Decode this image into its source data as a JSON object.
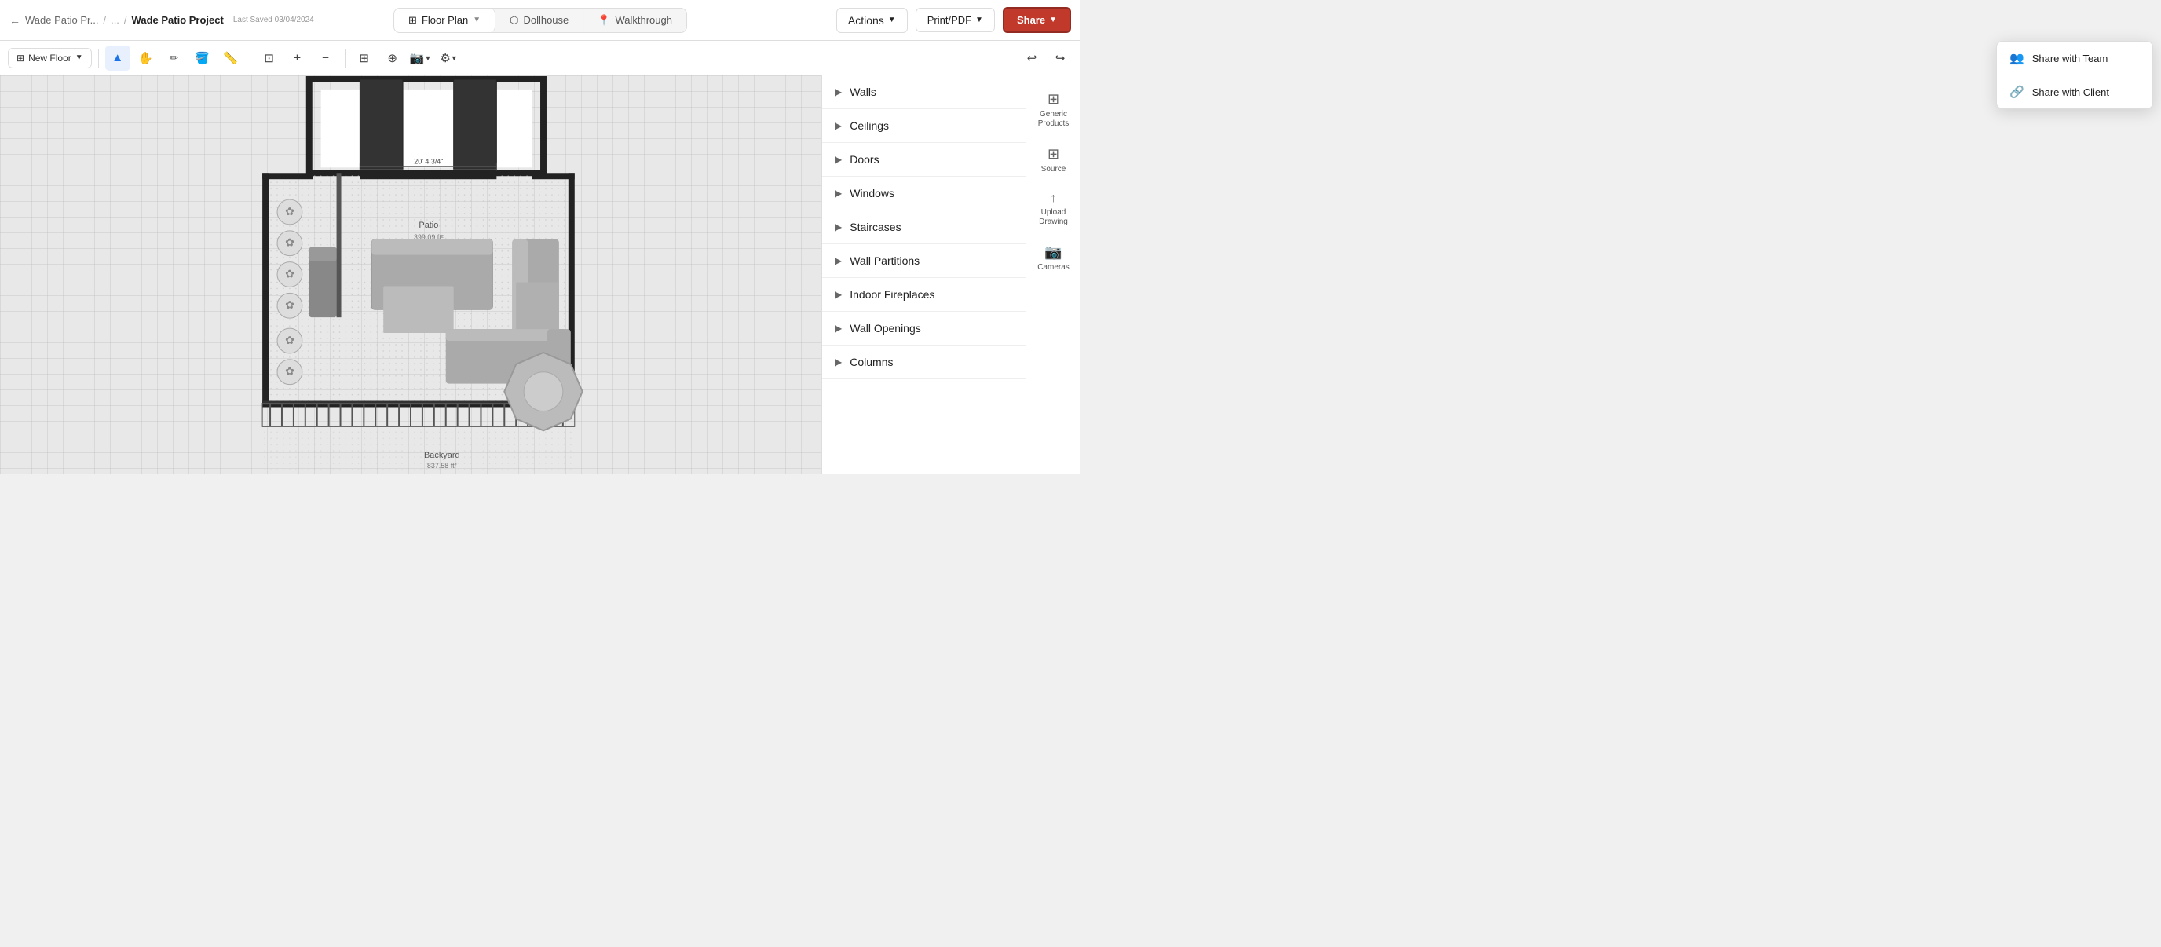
{
  "header": {
    "breadcrumb": {
      "back_icon": "←",
      "item1": "Wade Patio Pr...",
      "separator1": "/",
      "ellipsis": "...",
      "separator2": "/",
      "current": "Wade Patio Project"
    },
    "saved_text": "Last Saved 03/04/2024",
    "view_tabs": [
      {
        "id": "floor-plan",
        "label": "Floor Plan",
        "icon": "⊞",
        "active": true
      },
      {
        "id": "dollhouse",
        "label": "Dollhouse",
        "icon": "⬡",
        "active": false
      },
      {
        "id": "walkthrough",
        "label": "Walkthrough",
        "icon": "📍",
        "active": false
      }
    ],
    "actions_label": "Actions",
    "print_label": "Print/PDF",
    "share_label": "Share"
  },
  "toolbar": {
    "new_floor_label": "New Floor",
    "tools": [
      {
        "id": "select",
        "icon": "▲",
        "label": "Select"
      },
      {
        "id": "pan",
        "icon": "✋",
        "label": "Pan"
      },
      {
        "id": "draw-wall",
        "icon": "✏",
        "label": "Draw Wall"
      },
      {
        "id": "paint",
        "icon": "🪣",
        "label": "Paint"
      },
      {
        "id": "measure",
        "icon": "📏",
        "label": "Measure"
      }
    ],
    "zoom_tools": [
      {
        "id": "fit",
        "icon": "⊡",
        "label": "Fit"
      },
      {
        "id": "zoom-in",
        "icon": "+",
        "label": "Zoom In"
      },
      {
        "id": "zoom-out",
        "icon": "−",
        "label": "Zoom Out"
      }
    ],
    "snap_icon": "⊞",
    "camera_icon": "📷",
    "settings_icon": "⚙",
    "undo_icon": "↩",
    "redo_icon": "↪"
  },
  "right_panel": {
    "sections": [
      {
        "id": "walls",
        "label": "Walls"
      },
      {
        "id": "ceilings",
        "label": "Ceilings"
      },
      {
        "id": "doors",
        "label": "Doors"
      },
      {
        "id": "windows",
        "label": "Windows"
      },
      {
        "id": "staircases",
        "label": "Staircases"
      },
      {
        "id": "wall-partitions",
        "label": "Wall Partitions"
      },
      {
        "id": "indoor-fireplaces",
        "label": "Indoor Fireplaces"
      },
      {
        "id": "wall-openings",
        "label": "Wall Openings"
      },
      {
        "id": "columns",
        "label": "Columns"
      }
    ]
  },
  "far_right": {
    "items": [
      {
        "id": "generic-products",
        "icon": "⊞",
        "label": "Generic Products"
      },
      {
        "id": "source",
        "icon": "⊞",
        "label": "Source"
      },
      {
        "id": "upload-drawing",
        "icon": "↑",
        "label": "Upload Drawing"
      },
      {
        "id": "cameras",
        "icon": "📷",
        "label": "Cameras"
      }
    ]
  },
  "dropdown": {
    "items": [
      {
        "id": "share-team",
        "icon": "👥",
        "label": "Share with Team"
      },
      {
        "id": "share-client",
        "icon": "🔗",
        "label": "Share with Client"
      }
    ]
  },
  "canvas": {
    "room1_label": "Patio",
    "room1_area": "399.09 ft²",
    "room2_label": "Backyard",
    "room2_area": "837.58 ft²",
    "measurement": "20' 4 3/4\""
  }
}
